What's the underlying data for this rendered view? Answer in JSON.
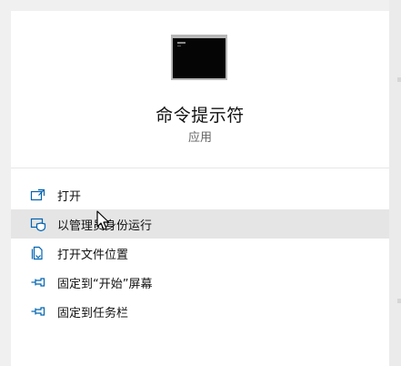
{
  "app": {
    "title": "命令提示符",
    "subtitle": "应用",
    "icon": "command-prompt-icon"
  },
  "menu": {
    "items": [
      {
        "label": "打开",
        "icon": "open-icon"
      },
      {
        "label": "以管理员身份运行",
        "icon": "run-as-admin-icon",
        "hovered": true
      },
      {
        "label": "打开文件位置",
        "icon": "file-location-icon"
      },
      {
        "label": "固定到“开始”屏幕",
        "icon": "pin-icon"
      },
      {
        "label": "固定到任务栏",
        "icon": "pin-icon"
      }
    ]
  },
  "colors": {
    "accent": "#0063b1",
    "hover": "#e5e5e5",
    "panel": "#ffffff"
  }
}
